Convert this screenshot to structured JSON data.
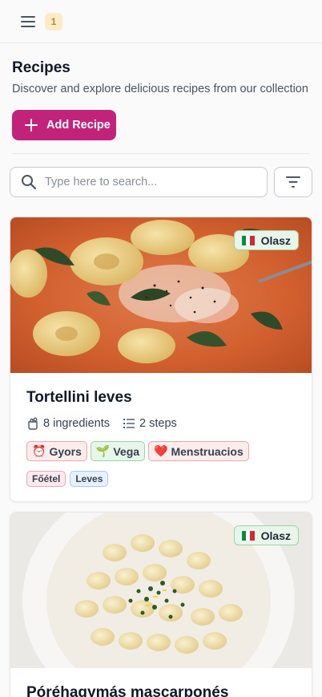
{
  "header": {
    "notification_count": "1"
  },
  "page": {
    "title": "Recipes",
    "subtitle": "Discover and explore delicious recipes from our collection",
    "add_label": "Add Recipe"
  },
  "search": {
    "placeholder": "Type here to search..."
  },
  "recipes": [
    {
      "title": "Tortellini leves",
      "cuisine": "Olasz",
      "ingredients": "8 ingredients",
      "steps": "2 steps",
      "tags": [
        {
          "emoji": "⏰",
          "label": "Gyors"
        },
        {
          "emoji": "🌱",
          "label": "Vega"
        },
        {
          "emoji": "❤️",
          "label": "Menstruacios"
        }
      ],
      "categories": [
        "Főétel",
        "Leves"
      ]
    },
    {
      "title": "Póréhagymás mascarponés",
      "cuisine": "Olasz"
    }
  ],
  "colors": {
    "accent": "#c2237a",
    "badge_bg": "#fdebc8",
    "badge_text": "#c68a17",
    "cuisine_bg": "#e8f5ea"
  },
  "icons": [
    "menu-icon",
    "plus-icon",
    "search-icon",
    "filter-icon",
    "ingredients-icon",
    "steps-icon",
    "italy-flag-icon"
  ]
}
